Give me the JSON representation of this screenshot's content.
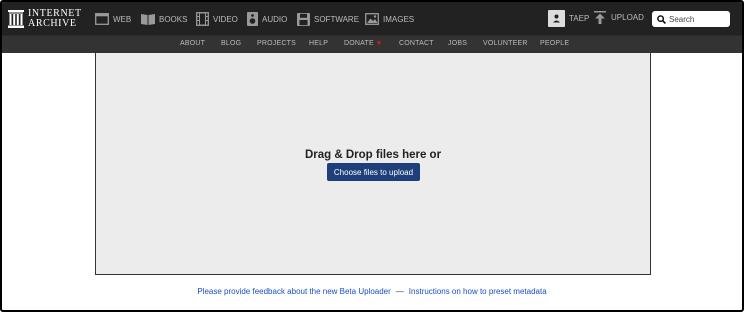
{
  "logo": {
    "line1": "INTERNET",
    "line2": "ARCHIVE"
  },
  "mediatypes": [
    {
      "label": "WEB",
      "icon": "web-icon"
    },
    {
      "label": "BOOKS",
      "icon": "books-icon"
    },
    {
      "label": "VIDEO",
      "icon": "video-icon"
    },
    {
      "label": "AUDIO",
      "icon": "audio-icon"
    },
    {
      "label": "SOFTWARE",
      "icon": "software-icon"
    },
    {
      "label": "IMAGES",
      "icon": "images-icon"
    }
  ],
  "user": {
    "name": "TAEP",
    "icon": "user-avatar-icon"
  },
  "upload": {
    "label": "UPLOAD",
    "icon": "upload-icon"
  },
  "search": {
    "placeholder": "Search",
    "icon": "search-icon"
  },
  "subnav": [
    "ABOUT",
    "BLOG",
    "PROJECTS",
    "HELP",
    "DONATE",
    "CONTACT",
    "JOBS",
    "VOLUNTEER",
    "PEOPLE"
  ],
  "donate_heart": "♥",
  "dropzone": {
    "title": "Drag & Drop files here or",
    "button": "Choose files to upload"
  },
  "footer": {
    "feedback_link": "Please provide feedback about the new Beta Uploader",
    "separator": "—",
    "instructions_link": "Instructions on how to preset metadata"
  },
  "colors": {
    "topbar": "#222222",
    "subnav": "#333333",
    "button": "#1e3f7a",
    "link": "#1a4fc4",
    "heart": "#e0161c"
  }
}
